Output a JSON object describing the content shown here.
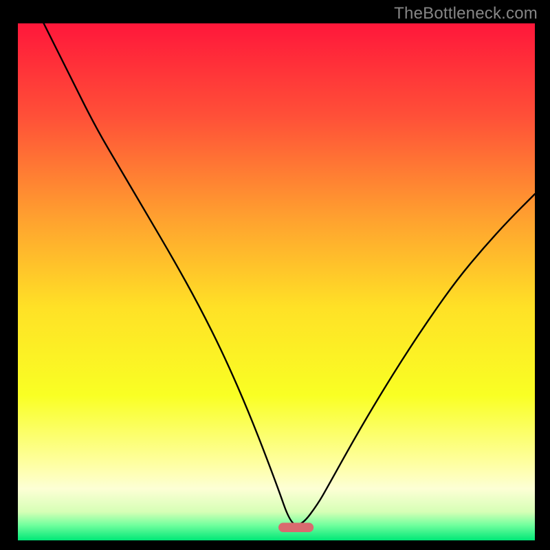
{
  "watermark": "TheBottleneck.com",
  "chart_data": {
    "type": "line",
    "title": "",
    "xlabel": "",
    "ylabel": "",
    "xlim": [
      0,
      1
    ],
    "ylim": [
      0,
      1
    ],
    "grid": false,
    "legend": false,
    "gradient_stops": [
      {
        "offset": 0.0,
        "color": "#ff173a"
      },
      {
        "offset": 0.18,
        "color": "#ff5038"
      },
      {
        "offset": 0.38,
        "color": "#ffa22f"
      },
      {
        "offset": 0.55,
        "color": "#ffe126"
      },
      {
        "offset": 0.72,
        "color": "#f9ff24"
      },
      {
        "offset": 0.85,
        "color": "#feffa0"
      },
      {
        "offset": 0.9,
        "color": "#fdffd5"
      },
      {
        "offset": 0.945,
        "color": "#d6ffb6"
      },
      {
        "offset": 0.97,
        "color": "#73ff9e"
      },
      {
        "offset": 1.0,
        "color": "#00e777"
      }
    ],
    "series": [
      {
        "name": "bottleneck-curve",
        "x": [
          0.0,
          0.05,
          0.1,
          0.15,
          0.2,
          0.25,
          0.3,
          0.35,
          0.4,
          0.45,
          0.5,
          0.528,
          0.55,
          0.58,
          0.6,
          0.65,
          0.7,
          0.75,
          0.8,
          0.85,
          0.9,
          0.95,
          1.0
        ],
        "values": [
          1.1,
          1.0,
          0.9,
          0.8,
          0.715,
          0.63,
          0.545,
          0.455,
          0.355,
          0.24,
          0.11,
          0.03,
          0.03,
          0.07,
          0.105,
          0.195,
          0.28,
          0.36,
          0.435,
          0.505,
          0.565,
          0.62,
          0.67
        ]
      }
    ],
    "marker": {
      "name": "optimal-range",
      "shape": "capsule",
      "x_center": 0.538,
      "y_center": 0.025,
      "width": 0.068,
      "height": 0.018,
      "color": "#d96a6f"
    }
  }
}
